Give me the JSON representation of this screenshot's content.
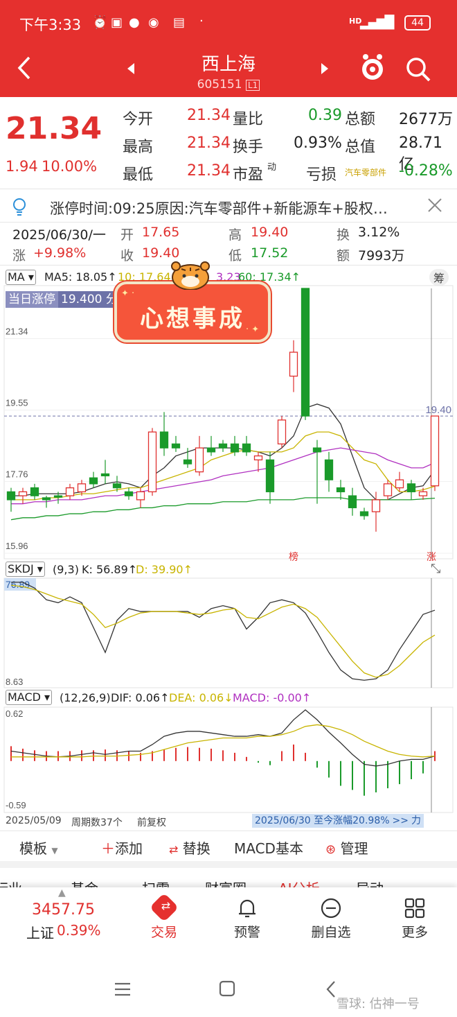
{
  "status_bar": {
    "time": "下午3:33",
    "signal": "HD",
    "battery": "44"
  },
  "header": {
    "stock_name": "西上海",
    "stock_code": "605151",
    "code_badge": "L1"
  },
  "quote": {
    "price": "21.34",
    "change": "1.94",
    "change_pct": "10.00%",
    "rows": [
      {
        "l1": "今开",
        "v1": "21.34",
        "l2": "量比",
        "v2": "0.39",
        "l3": "总额",
        "v3": "2677万"
      },
      {
        "l1": "最高",
        "v1": "21.34",
        "l2": "换手",
        "v2": "0.93%",
        "l3": "总值",
        "v3": "28.71亿"
      },
      {
        "l1": "最低",
        "v1": "21.34",
        "l2": "市盈",
        "l2sup": "动",
        "l3": "亏损",
        "sector": "汽车零部件",
        "v3": "-0.28%"
      }
    ]
  },
  "notice": {
    "text": "涨停时间:09:25原因:汽车零部件+新能源车+股权…"
  },
  "day_info": {
    "date": "2025/06/30/一",
    "open_label": "开",
    "open": "17.65",
    "high_label": "高",
    "high": "19.40",
    "turn_label": "换",
    "turn": "3.12%",
    "chg_label": "涨",
    "chg": "+9.98%",
    "close_label": "收",
    "close": "19.40",
    "low_label": "低",
    "low": "17.52",
    "amt_label": "额",
    "amt": "7993万"
  },
  "ma_legend": {
    "name": "MA",
    "ma5": "MA5: 18.05↑",
    "ma10": "10: 17.64",
    "ma20": "3.23",
    "ma60": "60: 17.34↑",
    "right_btn": "筹"
  },
  "limit_tag": {
    "label": "当日涨停",
    "value": "19.400 分"
  },
  "sticker": {
    "text": "心想事成"
  },
  "chart_data": [
    {
      "type": "candlestick",
      "title": "K线",
      "y_ticks": [
        "21.34",
        "19.55",
        "17.76",
        "15.96"
      ],
      "ylim": [
        15.96,
        22.6
      ],
      "current_price_label": "19.40",
      "bottom_marks": [
        "榜",
        "涨"
      ],
      "candles": [
        {
          "o": 17.3,
          "h": 17.6,
          "l": 17.0,
          "c": 17.5,
          "up": false
        },
        {
          "o": 17.4,
          "h": 17.6,
          "l": 17.2,
          "c": 17.5,
          "up": true
        },
        {
          "o": 17.6,
          "h": 17.7,
          "l": 17.3,
          "c": 17.4,
          "up": false
        },
        {
          "o": 17.3,
          "h": 17.4,
          "l": 17.1,
          "c": 17.35,
          "up": false
        },
        {
          "o": 17.4,
          "h": 17.5,
          "l": 17.2,
          "c": 17.4,
          "up": false
        },
        {
          "o": 17.4,
          "h": 17.7,
          "l": 17.3,
          "c": 17.6,
          "up": true
        },
        {
          "o": 17.5,
          "h": 17.8,
          "l": 17.4,
          "c": 17.7,
          "up": true
        },
        {
          "o": 17.7,
          "h": 18.0,
          "l": 17.6,
          "c": 17.85,
          "up": false
        },
        {
          "o": 17.9,
          "h": 18.3,
          "l": 17.7,
          "c": 17.95,
          "up": false
        },
        {
          "o": 17.7,
          "h": 17.9,
          "l": 17.5,
          "c": 17.6,
          "up": false
        },
        {
          "o": 17.5,
          "h": 17.6,
          "l": 17.3,
          "c": 17.4,
          "up": false
        },
        {
          "o": 17.3,
          "h": 17.6,
          "l": 17.1,
          "c": 17.5,
          "up": true
        },
        {
          "o": 17.5,
          "h": 19.1,
          "l": 17.4,
          "c": 19.0,
          "up": true
        },
        {
          "o": 19.0,
          "h": 19.5,
          "l": 18.4,
          "c": 18.6,
          "up": false
        },
        {
          "o": 18.6,
          "h": 18.9,
          "l": 18.5,
          "c": 18.7,
          "up": false
        },
        {
          "o": 18.2,
          "h": 18.6,
          "l": 18.1,
          "c": 18.3,
          "up": false
        },
        {
          "o": 18.0,
          "h": 18.9,
          "l": 17.9,
          "c": 18.6,
          "up": true
        },
        {
          "o": 18.6,
          "h": 18.9,
          "l": 18.4,
          "c": 18.5,
          "up": false
        },
        {
          "o": 18.6,
          "h": 18.8,
          "l": 18.5,
          "c": 18.7,
          "up": false
        },
        {
          "o": 18.7,
          "h": 18.9,
          "l": 18.4,
          "c": 18.5,
          "up": false
        },
        {
          "o": 18.7,
          "h": 18.9,
          "l": 18.4,
          "c": 18.5,
          "up": false
        },
        {
          "o": 18.3,
          "h": 18.5,
          "l": 18.0,
          "c": 18.4,
          "up": true
        },
        {
          "o": 18.3,
          "h": 18.5,
          "l": 17.2,
          "c": 17.5,
          "up": false
        },
        {
          "o": 18.7,
          "h": 19.4,
          "l": 18.6,
          "c": 19.3,
          "up": true
        },
        {
          "o": 20.4,
          "h": 21.3,
          "l": 20.0,
          "c": 21.0,
          "up": true
        },
        {
          "o": 19.4,
          "h": 22.6,
          "l": 19.3,
          "c": 22.6,
          "up": false
        },
        {
          "o": 18.6,
          "h": 18.8,
          "l": 17.2,
          "c": 18.5,
          "up": false
        },
        {
          "o": 18.3,
          "h": 18.5,
          "l": 17.5,
          "c": 17.8,
          "up": false
        },
        {
          "o": 17.6,
          "h": 17.8,
          "l": 17.3,
          "c": 17.5,
          "up": false
        },
        {
          "o": 17.4,
          "h": 17.6,
          "l": 16.9,
          "c": 17.1,
          "up": false
        },
        {
          "o": 17.0,
          "h": 17.1,
          "l": 16.8,
          "c": 16.9,
          "up": false
        },
        {
          "o": 17.0,
          "h": 17.5,
          "l": 16.5,
          "c": 17.3,
          "up": true
        },
        {
          "o": 17.4,
          "h": 17.8,
          "l": 17.3,
          "c": 17.7,
          "up": true
        },
        {
          "o": 17.6,
          "h": 18.0,
          "l": 17.5,
          "c": 17.8,
          "up": true
        },
        {
          "o": 17.7,
          "h": 17.8,
          "l": 17.3,
          "c": 17.5,
          "up": false
        },
        {
          "o": 17.4,
          "h": 17.6,
          "l": 17.3,
          "c": 17.5,
          "up": true
        },
        {
          "o": 17.65,
          "h": 19.4,
          "l": 17.52,
          "c": 19.4,
          "up": true
        }
      ],
      "series": [
        {
          "name": "MA5",
          "values": [
            17.4,
            17.4,
            17.45,
            17.45,
            17.45,
            17.45,
            17.5,
            17.6,
            17.7,
            17.75,
            17.7,
            17.6,
            17.9,
            18.1,
            18.4,
            18.5,
            18.6,
            18.6,
            18.6,
            18.6,
            18.55,
            18.5,
            18.4,
            18.6,
            18.9,
            19.6,
            19.7,
            19.6,
            19.2,
            18.4,
            17.6,
            17.3,
            17.3,
            17.45,
            17.6,
            17.65,
            18.05
          ]
        },
        {
          "name": "MA10",
          "values": [
            17.3,
            17.3,
            17.3,
            17.35,
            17.35,
            17.4,
            17.45,
            17.45,
            17.5,
            17.55,
            17.6,
            17.6,
            17.7,
            17.8,
            17.9,
            18.0,
            18.1,
            18.3,
            18.4,
            18.5,
            18.55,
            18.5,
            18.5,
            18.5,
            18.6,
            18.9,
            19.0,
            19.0,
            18.9,
            18.6,
            18.3,
            18.2,
            17.8,
            17.5,
            17.5,
            17.55,
            17.64
          ]
        },
        {
          "name": "MA20",
          "values": [
            17.2,
            17.2,
            17.25,
            17.25,
            17.3,
            17.3,
            17.3,
            17.35,
            17.4,
            17.4,
            17.45,
            17.5,
            17.55,
            17.6,
            17.65,
            17.7,
            17.75,
            17.8,
            17.9,
            17.95,
            18.0,
            18.05,
            18.1,
            18.2,
            18.3,
            18.4,
            18.5,
            18.55,
            18.6,
            18.55,
            18.5,
            18.45,
            18.3,
            18.2,
            18.1,
            18.1,
            18.23
          ]
        },
        {
          "name": "MA60",
          "values": [
            16.8,
            16.85,
            16.85,
            16.9,
            16.9,
            16.95,
            16.95,
            17.0,
            17.0,
            17.05,
            17.05,
            17.1,
            17.1,
            17.15,
            17.15,
            17.2,
            17.2,
            17.2,
            17.25,
            17.25,
            17.25,
            17.3,
            17.3,
            17.3,
            17.3,
            17.35,
            17.35,
            17.35,
            17.35,
            17.3,
            17.3,
            17.3,
            17.3,
            17.3,
            17.3,
            17.32,
            17.34
          ]
        }
      ]
    },
    {
      "type": "line",
      "title": "SKDJ",
      "params": "(9,3)",
      "k_label": "K: 56.89↑",
      "d_label": "D: 39.90↑",
      "y_ticks": [
        "76.89",
        "8.63"
      ],
      "ylim": [
        8.63,
        76.89
      ],
      "series": [
        {
          "name": "K",
          "values": [
            76,
            76,
            72,
            64,
            62,
            66,
            62,
            45,
            28,
            50,
            58,
            56,
            56,
            56,
            56,
            56,
            52,
            58,
            60,
            58,
            44,
            52,
            62,
            64,
            62,
            55,
            42,
            28,
            16,
            10,
            9,
            10,
            16,
            30,
            42,
            54,
            56.89
          ]
        },
        {
          "name": "D",
          "values": [
            74,
            73,
            71,
            68,
            65,
            63,
            61,
            54,
            45,
            48,
            52,
            55,
            56,
            56,
            56,
            55,
            54,
            55,
            57,
            58,
            52,
            51,
            55,
            59,
            61,
            58,
            52,
            42,
            32,
            22,
            14,
            11,
            13,
            19,
            27,
            35,
            39.9
          ]
        }
      ]
    },
    {
      "type": "bar",
      "title": "MACD",
      "params": "(12,26,9)",
      "dif_label": "DIF: 0.06↑",
      "dea_label": "DEA: 0.06↓",
      "macd_label": "MACD: -0.00↑",
      "y_ticks": [
        "0.62",
        "-0.59"
      ],
      "ylim": [
        -0.59,
        0.62
      ],
      "values": [
        0.18,
        0.15,
        0.13,
        0.12,
        0.12,
        0.12,
        0.13,
        0.13,
        0.14,
        0.13,
        0.12,
        0.1,
        0.12,
        0.14,
        0.16,
        0.17,
        0.16,
        0.15,
        0.13,
        0.1,
        0.05,
        -0.02,
        -0.05,
        0.12,
        0.2,
        0.1,
        -0.08,
        -0.2,
        -0.3,
        -0.35,
        -0.42,
        -0.38,
        -0.33,
        -0.28,
        -0.22,
        -0.15,
        0.12
      ],
      "series": [
        {
          "name": "DIF",
          "values": [
            0.12,
            0.1,
            0.08,
            0.06,
            0.05,
            0.06,
            0.08,
            0.1,
            0.08,
            0.1,
            0.12,
            0.12,
            0.2,
            0.3,
            0.34,
            0.36,
            0.36,
            0.34,
            0.32,
            0.3,
            0.3,
            0.32,
            0.3,
            0.34,
            0.5,
            0.62,
            0.5,
            0.35,
            0.22,
            0.08,
            -0.04,
            -0.06,
            -0.04,
            0.0,
            0.02,
            0.02,
            0.06
          ]
        },
        {
          "name": "DEA",
          "values": [
            0.05,
            0.05,
            0.05,
            0.05,
            0.05,
            0.05,
            0.05,
            0.06,
            0.06,
            0.06,
            0.07,
            0.08,
            0.1,
            0.14,
            0.18,
            0.22,
            0.24,
            0.26,
            0.28,
            0.28,
            0.28,
            0.3,
            0.3,
            0.32,
            0.36,
            0.42,
            0.44,
            0.42,
            0.38,
            0.32,
            0.24,
            0.18,
            0.12,
            0.08,
            0.06,
            0.05,
            0.06
          ]
        }
      ]
    }
  ],
  "chart_footer": {
    "start_date": "2025/05/09",
    "periods": "周期数37个",
    "adjust": "前复权",
    "range_text": "2025/06/30 至今涨幅20.98%",
    "range_arrow": ">>",
    "range_end": "力"
  },
  "toolbar": {
    "template": "模板",
    "add": "添加",
    "replace": "替换",
    "macd_basic": "MACD基本",
    "manage": "管理"
  },
  "tabs": [
    "行业",
    "基金",
    "扫雷",
    "财富圈",
    "AI分析",
    "异动",
    "一"
  ],
  "bottom_nav": {
    "index_value": "3457.75",
    "index_name": "上证",
    "index_pct": "0.39%",
    "items": [
      "交易",
      "预警",
      "删自选",
      "更多"
    ]
  },
  "watermark": "雪球: 估神一号",
  "colors": {
    "brand_red": "#e5302e",
    "up": "#e0302e",
    "down": "#1a9a2a",
    "ma5": "#333333",
    "ma10": "#c8b400",
    "ma20": "#b030c0",
    "ma60": "#1a9a2a"
  }
}
